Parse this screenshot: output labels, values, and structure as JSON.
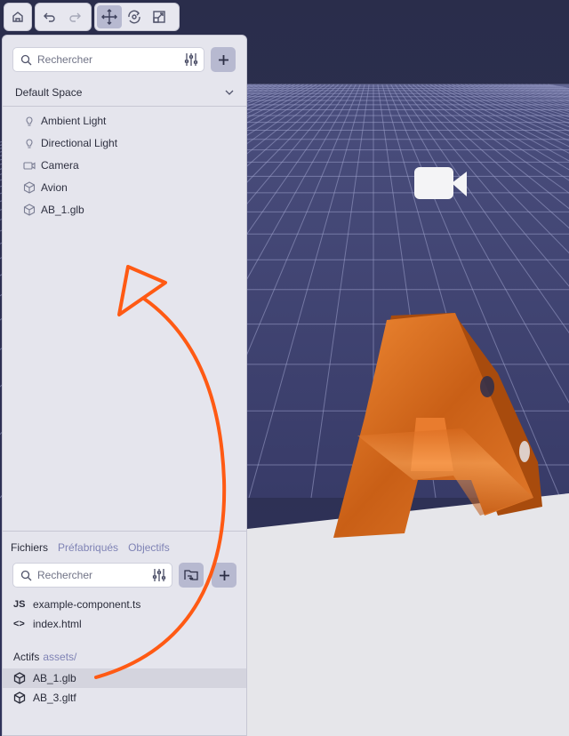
{
  "toolbar": {
    "groups": [
      {
        "buttons": [
          {
            "icon": "home-icon"
          }
        ]
      },
      {
        "buttons": [
          {
            "icon": "undo-icon"
          },
          {
            "icon": "redo-icon"
          }
        ]
      },
      {
        "buttons": [
          {
            "icon": "move-icon",
            "active": true
          },
          {
            "icon": "rotate-icon"
          },
          {
            "icon": "scale-icon"
          }
        ]
      }
    ]
  },
  "scene": {
    "search": {
      "placeholder": "Rechercher",
      "filter_icon": "sliders-icon",
      "add_icon": "plus-icon"
    },
    "space": {
      "label": "Default Space",
      "chevron_icon": "chevron-down-icon"
    },
    "items": [
      {
        "label": "Ambient Light",
        "icon": "lightbulb-icon"
      },
      {
        "label": "Directional Light",
        "icon": "lightbulb-icon"
      },
      {
        "label": "Camera",
        "icon": "camera-icon"
      },
      {
        "label": "Avion",
        "icon": "cube-icon"
      },
      {
        "label": "AB_1.glb",
        "icon": "cube-icon"
      }
    ]
  },
  "files": {
    "tabs": [
      {
        "label": "Fichiers",
        "active": true
      },
      {
        "label": "Préfabriqués",
        "active": false
      },
      {
        "label": "Objectifs",
        "active": false
      }
    ],
    "search": {
      "placeholder": "Rechercher",
      "filter_icon": "sliders-icon",
      "folder_icon": "folder-link-icon",
      "add_icon": "plus-icon"
    },
    "code_files": [
      {
        "label": "example-component.ts",
        "icon": "js-icon",
        "badge": "JS"
      },
      {
        "label": "index.html",
        "icon": "code-icon",
        "badge": "<>"
      }
    ],
    "assets": {
      "title": "Actifs",
      "path": "assets/",
      "items": [
        {
          "label": "AB_1.glb",
          "icon": "cube-icon",
          "selected": true
        },
        {
          "label": "AB_3.gltf",
          "icon": "cube-icon",
          "selected": false
        }
      ]
    }
  },
  "colors": {
    "sky": "#2b2e4d",
    "grid_floor": "#373a66",
    "ground": "#e6e6ea",
    "model_orange": "#e0772a",
    "annotation": "#ff5a14",
    "accent_button": "#b7b9d0",
    "link_text": "#7f83b5"
  }
}
